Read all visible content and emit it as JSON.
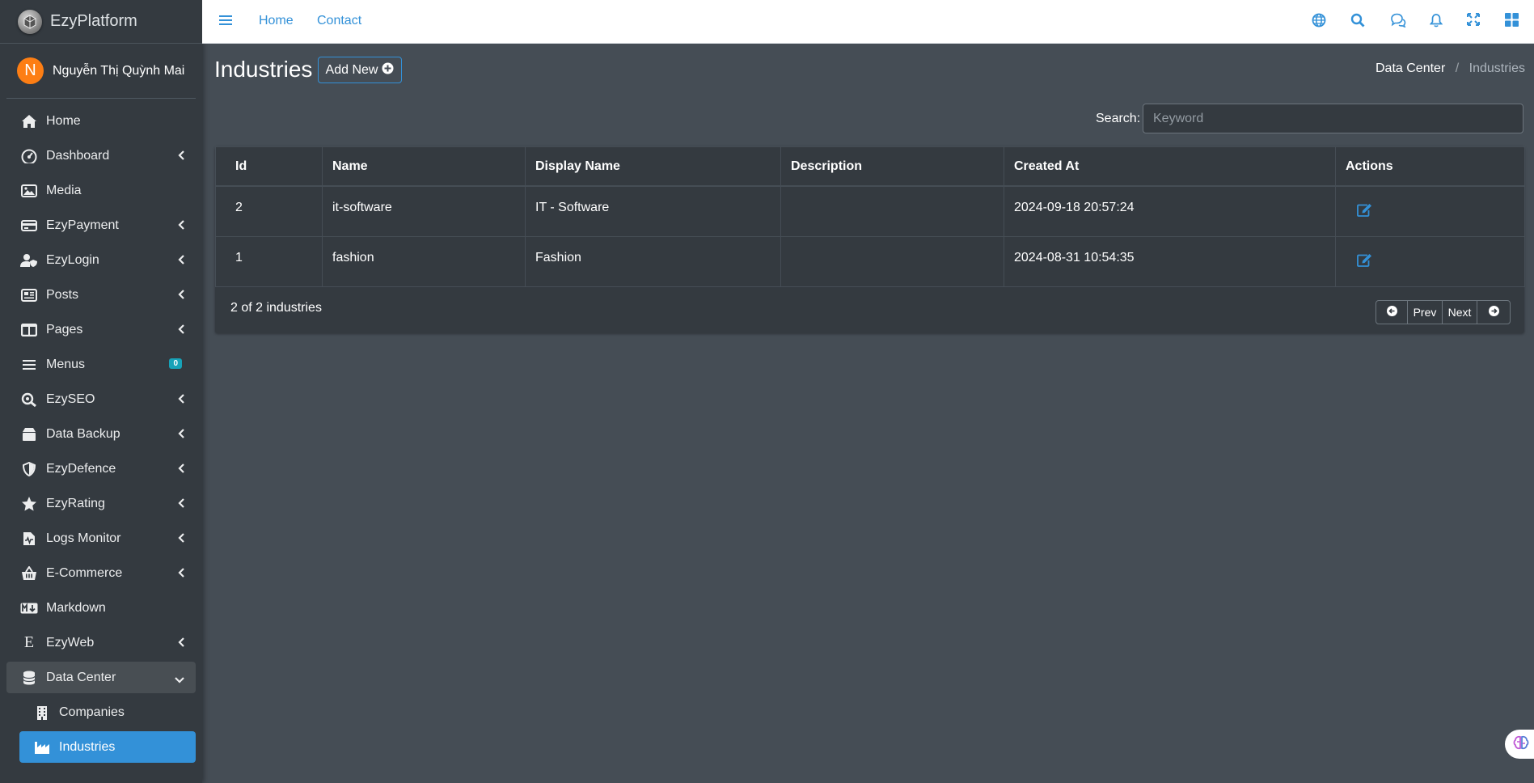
{
  "brand": {
    "name": "EzyPlatform"
  },
  "user": {
    "initial": "N",
    "name": "Nguyễn Thị Quỳnh Mai"
  },
  "sidebar": {
    "items": [
      {
        "label": "Home",
        "icon": "home-icon"
      },
      {
        "label": "Dashboard",
        "icon": "dashboard-gauge-icon"
      },
      {
        "label": "Media",
        "icon": "image-icon"
      },
      {
        "label": "EzyPayment",
        "icon": "credit-card-icon"
      },
      {
        "label": "EzyLogin",
        "icon": "user-shield-icon"
      },
      {
        "label": "Posts",
        "icon": "newspaper-icon"
      },
      {
        "label": "Pages",
        "icon": "columns-icon"
      },
      {
        "label": "Menus",
        "icon": "bars-icon",
        "badge": "0"
      },
      {
        "label": "EzySEO",
        "icon": "search-plus-icon"
      },
      {
        "label": "Data Backup",
        "icon": "box-icon"
      },
      {
        "label": "EzyDefence",
        "icon": "shield-icon"
      },
      {
        "label": "EzyRating",
        "icon": "star-icon"
      },
      {
        "label": "Logs Monitor",
        "icon": "file-waveform-icon"
      },
      {
        "label": "E-Commerce",
        "icon": "basket-icon"
      },
      {
        "label": "Markdown",
        "icon": "markdown-icon"
      },
      {
        "label": "EzyWeb",
        "icon": "letter-e-icon"
      },
      {
        "label": "Data Center",
        "icon": "database-icon"
      },
      {
        "label": "Companies",
        "icon": "building-icon"
      },
      {
        "label": "Industries",
        "icon": "industry-icon"
      }
    ]
  },
  "topbar": {
    "links": [
      "Home",
      "Contact"
    ]
  },
  "page": {
    "title": "Industries",
    "add_button": "Add New"
  },
  "breadcrumb": {
    "parent": "Data Center",
    "separator": "/",
    "current": "Industries"
  },
  "search": {
    "label": "Search:",
    "placeholder": "Keyword",
    "value": ""
  },
  "table": {
    "headers": [
      "Id",
      "Name",
      "Display Name",
      "Description",
      "Created At",
      "Actions"
    ],
    "rows": [
      {
        "id": "2",
        "name": "it-software",
        "display_name": "IT - Software",
        "description": "",
        "created_at": "2024-09-18 20:57:24"
      },
      {
        "id": "1",
        "name": "fashion",
        "display_name": "Fashion",
        "description": "",
        "created_at": "2024-08-31 10:54:35"
      }
    ]
  },
  "footer": {
    "count_text": "2 of 2 industries",
    "prev": "Prev",
    "next": "Next"
  },
  "colors": {
    "accent": "#3391d8",
    "sidebar_bg": "#343a40",
    "content_bg": "#454d55",
    "avatar": "#fd7e14",
    "badge": "#17a2b8"
  }
}
